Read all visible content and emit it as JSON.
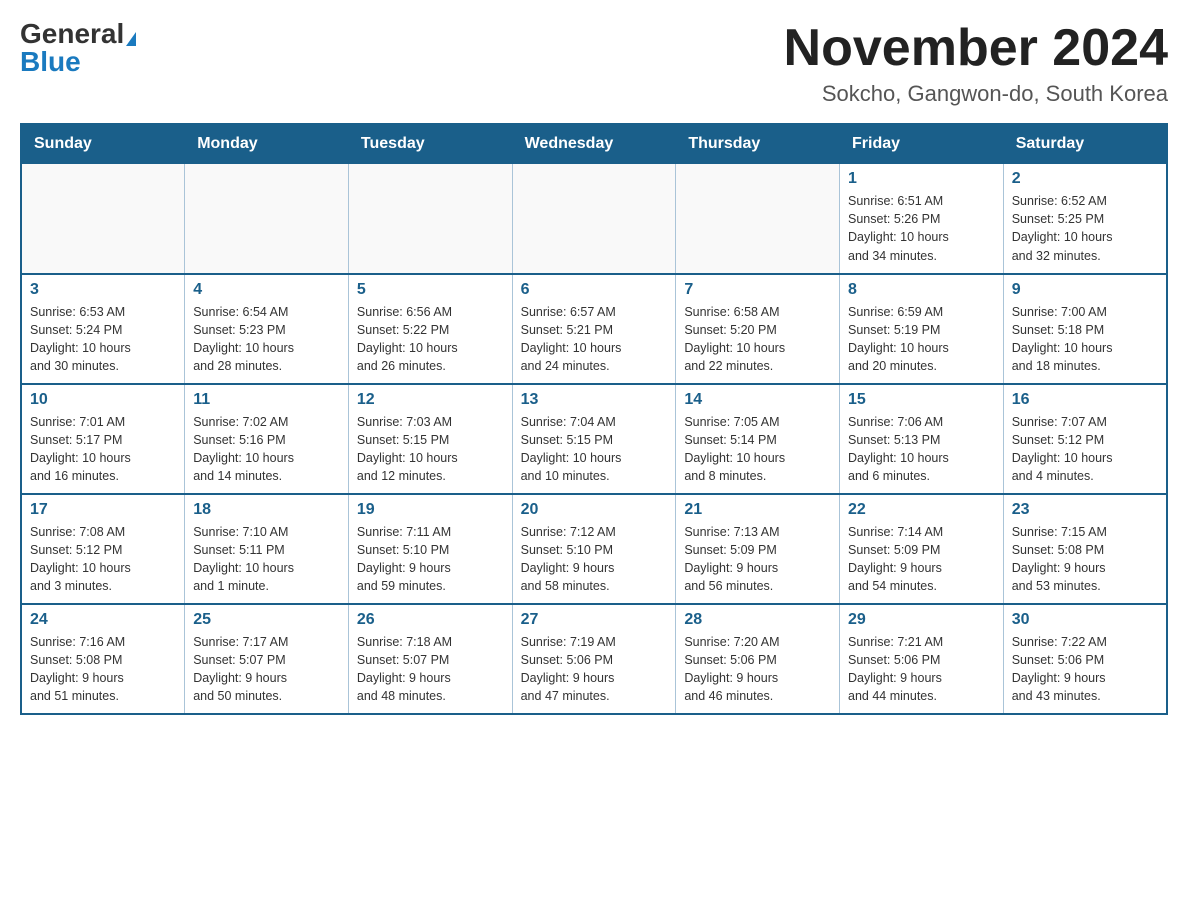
{
  "header": {
    "logo_general": "General",
    "logo_blue": "Blue",
    "month_title": "November 2024",
    "location": "Sokcho, Gangwon-do, South Korea"
  },
  "days_of_week": [
    "Sunday",
    "Monday",
    "Tuesday",
    "Wednesday",
    "Thursday",
    "Friday",
    "Saturday"
  ],
  "weeks": [
    [
      {
        "day": "",
        "info": ""
      },
      {
        "day": "",
        "info": ""
      },
      {
        "day": "",
        "info": ""
      },
      {
        "day": "",
        "info": ""
      },
      {
        "day": "",
        "info": ""
      },
      {
        "day": "1",
        "info": "Sunrise: 6:51 AM\nSunset: 5:26 PM\nDaylight: 10 hours\nand 34 minutes."
      },
      {
        "day": "2",
        "info": "Sunrise: 6:52 AM\nSunset: 5:25 PM\nDaylight: 10 hours\nand 32 minutes."
      }
    ],
    [
      {
        "day": "3",
        "info": "Sunrise: 6:53 AM\nSunset: 5:24 PM\nDaylight: 10 hours\nand 30 minutes."
      },
      {
        "day": "4",
        "info": "Sunrise: 6:54 AM\nSunset: 5:23 PM\nDaylight: 10 hours\nand 28 minutes."
      },
      {
        "day": "5",
        "info": "Sunrise: 6:56 AM\nSunset: 5:22 PM\nDaylight: 10 hours\nand 26 minutes."
      },
      {
        "day": "6",
        "info": "Sunrise: 6:57 AM\nSunset: 5:21 PM\nDaylight: 10 hours\nand 24 minutes."
      },
      {
        "day": "7",
        "info": "Sunrise: 6:58 AM\nSunset: 5:20 PM\nDaylight: 10 hours\nand 22 minutes."
      },
      {
        "day": "8",
        "info": "Sunrise: 6:59 AM\nSunset: 5:19 PM\nDaylight: 10 hours\nand 20 minutes."
      },
      {
        "day": "9",
        "info": "Sunrise: 7:00 AM\nSunset: 5:18 PM\nDaylight: 10 hours\nand 18 minutes."
      }
    ],
    [
      {
        "day": "10",
        "info": "Sunrise: 7:01 AM\nSunset: 5:17 PM\nDaylight: 10 hours\nand 16 minutes."
      },
      {
        "day": "11",
        "info": "Sunrise: 7:02 AM\nSunset: 5:16 PM\nDaylight: 10 hours\nand 14 minutes."
      },
      {
        "day": "12",
        "info": "Sunrise: 7:03 AM\nSunset: 5:15 PM\nDaylight: 10 hours\nand 12 minutes."
      },
      {
        "day": "13",
        "info": "Sunrise: 7:04 AM\nSunset: 5:15 PM\nDaylight: 10 hours\nand 10 minutes."
      },
      {
        "day": "14",
        "info": "Sunrise: 7:05 AM\nSunset: 5:14 PM\nDaylight: 10 hours\nand 8 minutes."
      },
      {
        "day": "15",
        "info": "Sunrise: 7:06 AM\nSunset: 5:13 PM\nDaylight: 10 hours\nand 6 minutes."
      },
      {
        "day": "16",
        "info": "Sunrise: 7:07 AM\nSunset: 5:12 PM\nDaylight: 10 hours\nand 4 minutes."
      }
    ],
    [
      {
        "day": "17",
        "info": "Sunrise: 7:08 AM\nSunset: 5:12 PM\nDaylight: 10 hours\nand 3 minutes."
      },
      {
        "day": "18",
        "info": "Sunrise: 7:10 AM\nSunset: 5:11 PM\nDaylight: 10 hours\nand 1 minute."
      },
      {
        "day": "19",
        "info": "Sunrise: 7:11 AM\nSunset: 5:10 PM\nDaylight: 9 hours\nand 59 minutes."
      },
      {
        "day": "20",
        "info": "Sunrise: 7:12 AM\nSunset: 5:10 PM\nDaylight: 9 hours\nand 58 minutes."
      },
      {
        "day": "21",
        "info": "Sunrise: 7:13 AM\nSunset: 5:09 PM\nDaylight: 9 hours\nand 56 minutes."
      },
      {
        "day": "22",
        "info": "Sunrise: 7:14 AM\nSunset: 5:09 PM\nDaylight: 9 hours\nand 54 minutes."
      },
      {
        "day": "23",
        "info": "Sunrise: 7:15 AM\nSunset: 5:08 PM\nDaylight: 9 hours\nand 53 minutes."
      }
    ],
    [
      {
        "day": "24",
        "info": "Sunrise: 7:16 AM\nSunset: 5:08 PM\nDaylight: 9 hours\nand 51 minutes."
      },
      {
        "day": "25",
        "info": "Sunrise: 7:17 AM\nSunset: 5:07 PM\nDaylight: 9 hours\nand 50 minutes."
      },
      {
        "day": "26",
        "info": "Sunrise: 7:18 AM\nSunset: 5:07 PM\nDaylight: 9 hours\nand 48 minutes."
      },
      {
        "day": "27",
        "info": "Sunrise: 7:19 AM\nSunset: 5:06 PM\nDaylight: 9 hours\nand 47 minutes."
      },
      {
        "day": "28",
        "info": "Sunrise: 7:20 AM\nSunset: 5:06 PM\nDaylight: 9 hours\nand 46 minutes."
      },
      {
        "day": "29",
        "info": "Sunrise: 7:21 AM\nSunset: 5:06 PM\nDaylight: 9 hours\nand 44 minutes."
      },
      {
        "day": "30",
        "info": "Sunrise: 7:22 AM\nSunset: 5:06 PM\nDaylight: 9 hours\nand 43 minutes."
      }
    ]
  ]
}
